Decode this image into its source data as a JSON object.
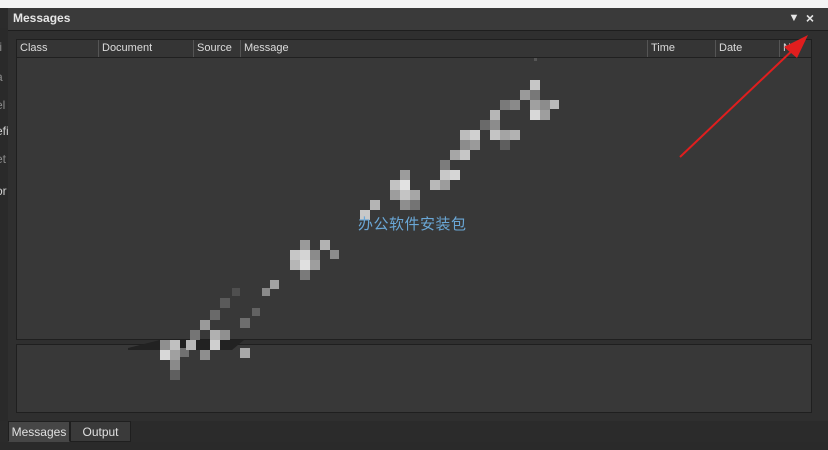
{
  "panel": {
    "title": "Messages",
    "menu_icon": "▼",
    "close_icon": "×"
  },
  "left_fragments": [
    "ti",
    "a",
    "el",
    "efi",
    "et",
    "or"
  ],
  "columns": [
    "Class",
    "Document",
    "Source",
    "Message",
    "Time",
    "Date",
    "No."
  ],
  "tabs": [
    {
      "label": "Messages",
      "active": true
    },
    {
      "label": "Output",
      "active": false
    }
  ],
  "watermark_text": "办公软件安装包",
  "colors": {
    "panel_bg": "#2f2f2f",
    "grid_bg": "#383838",
    "watermark_text": "#6aa7d6",
    "annotation_arrow": "#e01e1e"
  }
}
